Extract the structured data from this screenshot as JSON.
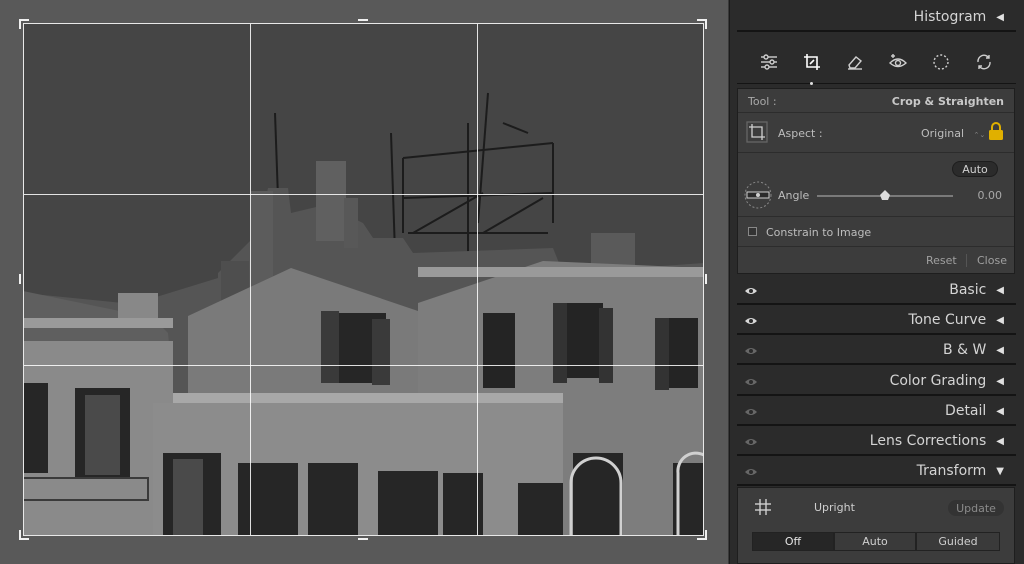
{
  "panel": {
    "histogram": "Histogram",
    "sections": [
      {
        "label": "Basic",
        "eye": "visible"
      },
      {
        "label": "Tone Curve",
        "eye": "visible"
      },
      {
        "label": "B & W",
        "eye": "dim"
      },
      {
        "label": "Color Grading",
        "eye": "dim"
      },
      {
        "label": "Detail",
        "eye": "dim"
      },
      {
        "label": "Lens Corrections",
        "eye": "dim"
      },
      {
        "label": "Transform",
        "eye": "dim"
      }
    ],
    "tools": [
      "edit-sliders-icon",
      "crop-icon",
      "healing-eraser-icon",
      "red-eye-icon",
      "masking-icon",
      "reset-rotate-icon"
    ]
  },
  "crop": {
    "tool_label": "Tool :",
    "tool_value": "Crop & Straighten",
    "aspect_label": "Aspect :",
    "aspect_value": "Original",
    "aspect_arrows": "⌃⌄",
    "auto": "Auto",
    "angle_label": "Angle",
    "angle_value": "0.00",
    "angle_fraction": 0.5,
    "constrain": "Constrain to Image",
    "reset": "Reset",
    "close": "Close"
  },
  "transform": {
    "upright": "Upright",
    "update": "Update",
    "modes": [
      "Off",
      "Auto",
      "Guided"
    ],
    "selected_mode": "Off"
  },
  "colors": {
    "panel_bg": "#2b2b2b",
    "lock": "#e0b000"
  }
}
